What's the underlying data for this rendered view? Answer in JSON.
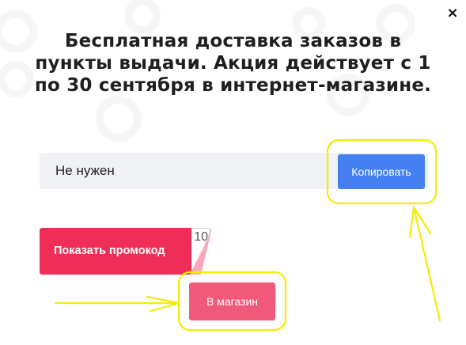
{
  "popup": {
    "title": "Бесплатная доставка заказов в пункты выдачи. Акция действует с 1 по 30 сентября в интернет-магазине.",
    "close_glyph": "×"
  },
  "coupon": {
    "code_value": "Не нужен",
    "copy_label": "Копировать"
  },
  "promo": {
    "show_label": "Показать промокод",
    "peek_code": "10"
  },
  "shop": {
    "label": "В магазин"
  },
  "colors": {
    "copy_button": "#4580f2",
    "promo_button": "#ee2e56",
    "shop_button": "#f1597b",
    "annotation": "#f2ee00"
  }
}
